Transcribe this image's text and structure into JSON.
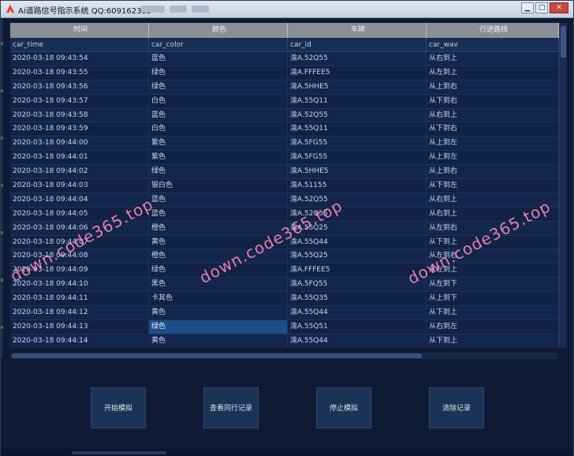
{
  "window": {
    "title": "Ai道路信号指示系统 QQ:609162385"
  },
  "table": {
    "headers_cn": [
      "时间",
      "颜色",
      "车牌",
      "行进路线"
    ],
    "headers_en": [
      "car_time",
      "car_color",
      "car_id",
      "car_wav"
    ],
    "rows": [
      [
        "2020-03-18 09:43:54",
        "蓝色",
        "渝A.52Q55",
        "从右到上"
      ],
      [
        "2020-03-18 09:43:55",
        "绿色",
        "渝A.FFFEE5",
        "从左到上"
      ],
      [
        "2020-03-18 09:43:56",
        "绿色",
        "渝A.5HHE5",
        "从上到右"
      ],
      [
        "2020-03-18 09:43:57",
        "白色",
        "渝A.55Q11",
        "从下到右"
      ],
      [
        "2020-03-18 09:43:58",
        "蓝色",
        "渝A.52Q55",
        "从右到上"
      ],
      [
        "2020-03-18 09:43:59",
        "白色",
        "渝A.55Q11",
        "从下到右"
      ],
      [
        "2020-03-18 09:44:00",
        "紫色",
        "渝A.5FG55",
        "从上到左"
      ],
      [
        "2020-03-18 09:44:01",
        "紫色",
        "渝A.5FG55",
        "从上到左"
      ],
      [
        "2020-03-18 09:44:02",
        "绿色",
        "渝A.5HHE5",
        "从上到右"
      ],
      [
        "2020-03-18 09:44:03",
        "银白色",
        "渝A.51155",
        "从下到左"
      ],
      [
        "2020-03-18 09:44:04",
        "蓝色",
        "渝A.52Q55",
        "从右到上"
      ],
      [
        "2020-03-18 09:44:05",
        "蓝色",
        "渝A.52Q55",
        "从右到上"
      ],
      [
        "2020-03-18 09:44:06",
        "橙色",
        "渝A.55Q25",
        "从左到右"
      ],
      [
        "2020-03-18 09:44:07",
        "黄色",
        "渝A.55Q44",
        "从下到上"
      ],
      [
        "2020-03-18 09:44:08",
        "橙色",
        "渝A.55Q25",
        "从左到右"
      ],
      [
        "2020-03-18 09:44:09",
        "绿色",
        "渝A.FFFEE5",
        "从左到上"
      ],
      [
        "2020-03-18 09:44:10",
        "黑色",
        "渝A.5FQ55",
        "从左到下"
      ],
      [
        "2020-03-18 09:44:11",
        "卡其色",
        "渝A.55Q35",
        "从上到下"
      ],
      [
        "2020-03-18 09:44:12",
        "黄色",
        "渝A.55Q44",
        "从下到上"
      ],
      [
        "2020-03-18 09:44:13",
        "绿色",
        "渝A.55Q51",
        "从右到左"
      ],
      [
        "2020-03-18 09:44:14",
        "黄色",
        "渝A.55Q44",
        "从下到上"
      ]
    ],
    "selected": {
      "row": 19,
      "col": 1
    }
  },
  "buttons": {
    "start": "开始模拟",
    "history": "查看同行记录",
    "stop": "停止模拟",
    "clear": "清除记录"
  },
  "watermark": "down.code365.top",
  "colors": {
    "background": "#0f1b35",
    "header_gray": "#8a8e96",
    "selected": "#1d4e86",
    "watermark": "#ff87be"
  }
}
